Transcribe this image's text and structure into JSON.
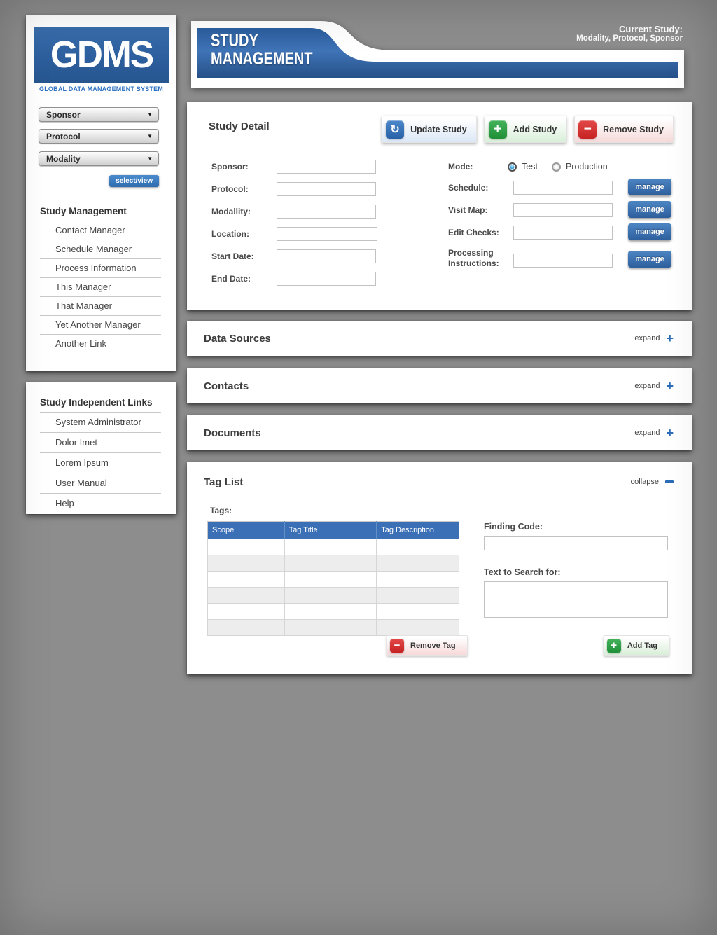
{
  "app": {
    "logo": "GDMS",
    "tagline": "GLOBAL DATA MANAGEMENT SYSTEM"
  },
  "icons": {
    "caret": "▼",
    "update": "↻",
    "add": "+",
    "remove": "−",
    "expand": "+"
  },
  "colors": {
    "accent_blue": "#2f6db8",
    "banner_blue": "#3f74b7",
    "table_header_blue": "#3b6fb6",
    "add_green": "#2aa344",
    "remove_red": "#d32f2f",
    "background_gray": "#8d8d8d"
  },
  "sidebar": {
    "filters": [
      {
        "label": "Sponsor"
      },
      {
        "label": "Protocol"
      },
      {
        "label": "Modality"
      }
    ],
    "select_view_label": "select/view",
    "menu_title": "Study Management",
    "menu_items": [
      "Contact Manager",
      "Schedule Manager",
      "Process Information",
      "This Manager",
      "That Manager",
      "Yet Another Manager",
      "Another Link"
    ],
    "links_title": "Study Independent Links",
    "links_items": [
      "System Administrator",
      "Dolor Imet",
      "Lorem Ipsum",
      "User Manual",
      "Help"
    ]
  },
  "header": {
    "banner_line1": "STUDY",
    "banner_line2": "MANAGEMENT",
    "current_study_label": "Current Study:",
    "current_study_value": "Modality, Protocol, Sponsor"
  },
  "study_detail": {
    "title": "Study Detail",
    "buttons": {
      "update": "Update Study",
      "add": "Add Study",
      "remove": "Remove Study"
    },
    "fields_left": [
      "Sponsor:",
      "Protocol:",
      "Modallity:",
      "Location:",
      "Start Date:",
      "End Date:"
    ],
    "mode": {
      "label": "Mode:",
      "options": [
        {
          "label": "Test",
          "selected": true
        },
        {
          "label": "Production",
          "selected": false
        }
      ]
    },
    "managed_fields": [
      "Schedule:",
      "Visit Map:",
      "Edit Checks:",
      "Processing Instructions:"
    ],
    "manage_label": "manage"
  },
  "sections": [
    {
      "title": "Data Sources",
      "action": "expand"
    },
    {
      "title": "Contacts",
      "action": "expand"
    },
    {
      "title": "Documents",
      "action": "expand"
    }
  ],
  "tag_list": {
    "title": "Tag List",
    "action": "collapse",
    "tags_label": "Tags:",
    "table": {
      "headers": [
        "Scope",
        "Tag Title",
        "Tag Description"
      ],
      "row_count": 6
    },
    "finding_code_label": "Finding Code:",
    "search_label": "Text to Search for:",
    "remove_button": "Remove Tag",
    "add_button": "Add Tag"
  }
}
